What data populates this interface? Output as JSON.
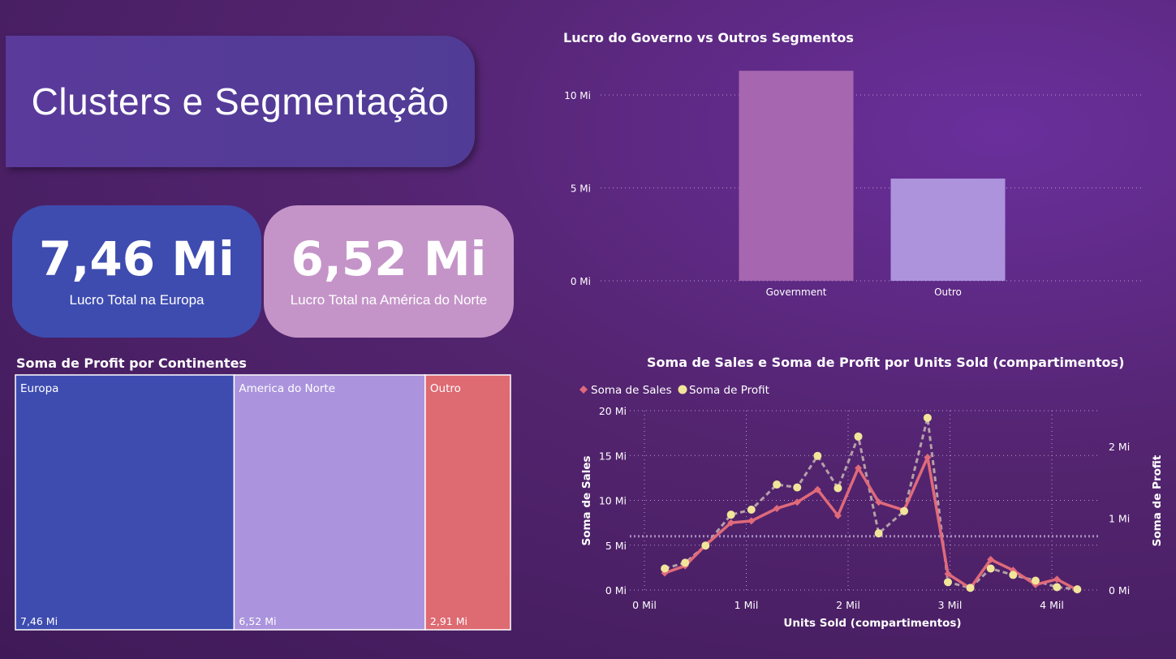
{
  "header": {
    "title": "Clusters e Segmentação"
  },
  "kpis": [
    {
      "value": "7,46 Mi",
      "label": "Lucro Total na Europa"
    },
    {
      "value": "6,52 Mi",
      "label": "Lucro Total na América do Norte"
    }
  ],
  "colors": {
    "europa": "#3e4cb0",
    "america": "#ab94dd",
    "outro_treemap": "#de6a72",
    "government": "#a666b0",
    "outro_bar": "#ac93dc",
    "sales_line": "#e06a7a",
    "profit_line": "#f1e59a"
  },
  "chart_data": [
    {
      "type": "bar",
      "title": "Lucro do Governo vs Outros Segmentos",
      "categories": [
        "Government",
        "Outro"
      ],
      "values": [
        11.3,
        5.5
      ],
      "ylim": [
        0,
        12
      ],
      "yticks": [
        "0 Mi",
        "5 Mi",
        "10 Mi"
      ],
      "ytick_values": [
        0,
        5,
        10
      ],
      "grid": true
    },
    {
      "type": "treemap",
      "title": "Soma de Profit por Continentes",
      "items": [
        {
          "name": "Europa",
          "value": 7.46,
          "label": "7,46 Mi"
        },
        {
          "name": "America do Norte",
          "value": 6.52,
          "label": "6,52 Mi"
        },
        {
          "name": "Outro",
          "value": 2.91,
          "label": "2,91 Mi"
        }
      ]
    },
    {
      "type": "line",
      "title": "Soma de Sales e Soma de Profit por Units Sold (compartimentos)",
      "xlabel": "Units Sold (compartimentos)",
      "ylabel": "Soma de Sales",
      "y2label": "Soma de Profit",
      "legend": [
        "Soma de  Sales",
        "Soma de Profit"
      ],
      "legend_position": "top-left",
      "xlim": [
        0,
        4.6
      ],
      "xticks": [
        "0 Mil",
        "1 Mil",
        "2 Mil",
        "3 Mil",
        "4 Mil"
      ],
      "xtick_values": [
        0,
        1,
        2,
        3,
        4
      ],
      "ylim": [
        0,
        20
      ],
      "yticks": [
        "0 Mi",
        "5 Mi",
        "10 Mi",
        "15 Mi",
        "20 Mi"
      ],
      "ytick_values": [
        0,
        5,
        10,
        15,
        20
      ],
      "y2lim": [
        0,
        2.5
      ],
      "y2ticks": [
        "0 Mi",
        "1 Mi",
        "2 Mi"
      ],
      "y2tick_values": [
        0,
        1,
        2
      ],
      "reference_line": 6.0,
      "x": [
        0.2,
        0.4,
        0.6,
        0.85,
        1.05,
        1.3,
        1.5,
        1.7,
        1.9,
        2.1,
        2.3,
        2.55,
        2.78,
        2.98,
        3.2,
        3.4,
        3.62,
        3.84,
        4.05,
        4.25
      ],
      "series": [
        {
          "name": "Soma de  Sales",
          "values": [
            1.9,
            2.7,
            5.0,
            7.5,
            7.7,
            9.1,
            9.8,
            11.2,
            8.3,
            13.6,
            9.8,
            8.9,
            14.8,
            1.8,
            0.2,
            3.4,
            2.2,
            0.6,
            1.2,
            0.0
          ]
        },
        {
          "name": "Soma de Profit",
          "values": [
            0.3,
            0.38,
            0.62,
            1.05,
            1.12,
            1.47,
            1.43,
            1.87,
            1.42,
            2.14,
            0.79,
            1.1,
            2.4,
            0.11,
            0.03,
            0.3,
            0.21,
            0.13,
            0.04,
            0.01
          ]
        }
      ]
    }
  ]
}
